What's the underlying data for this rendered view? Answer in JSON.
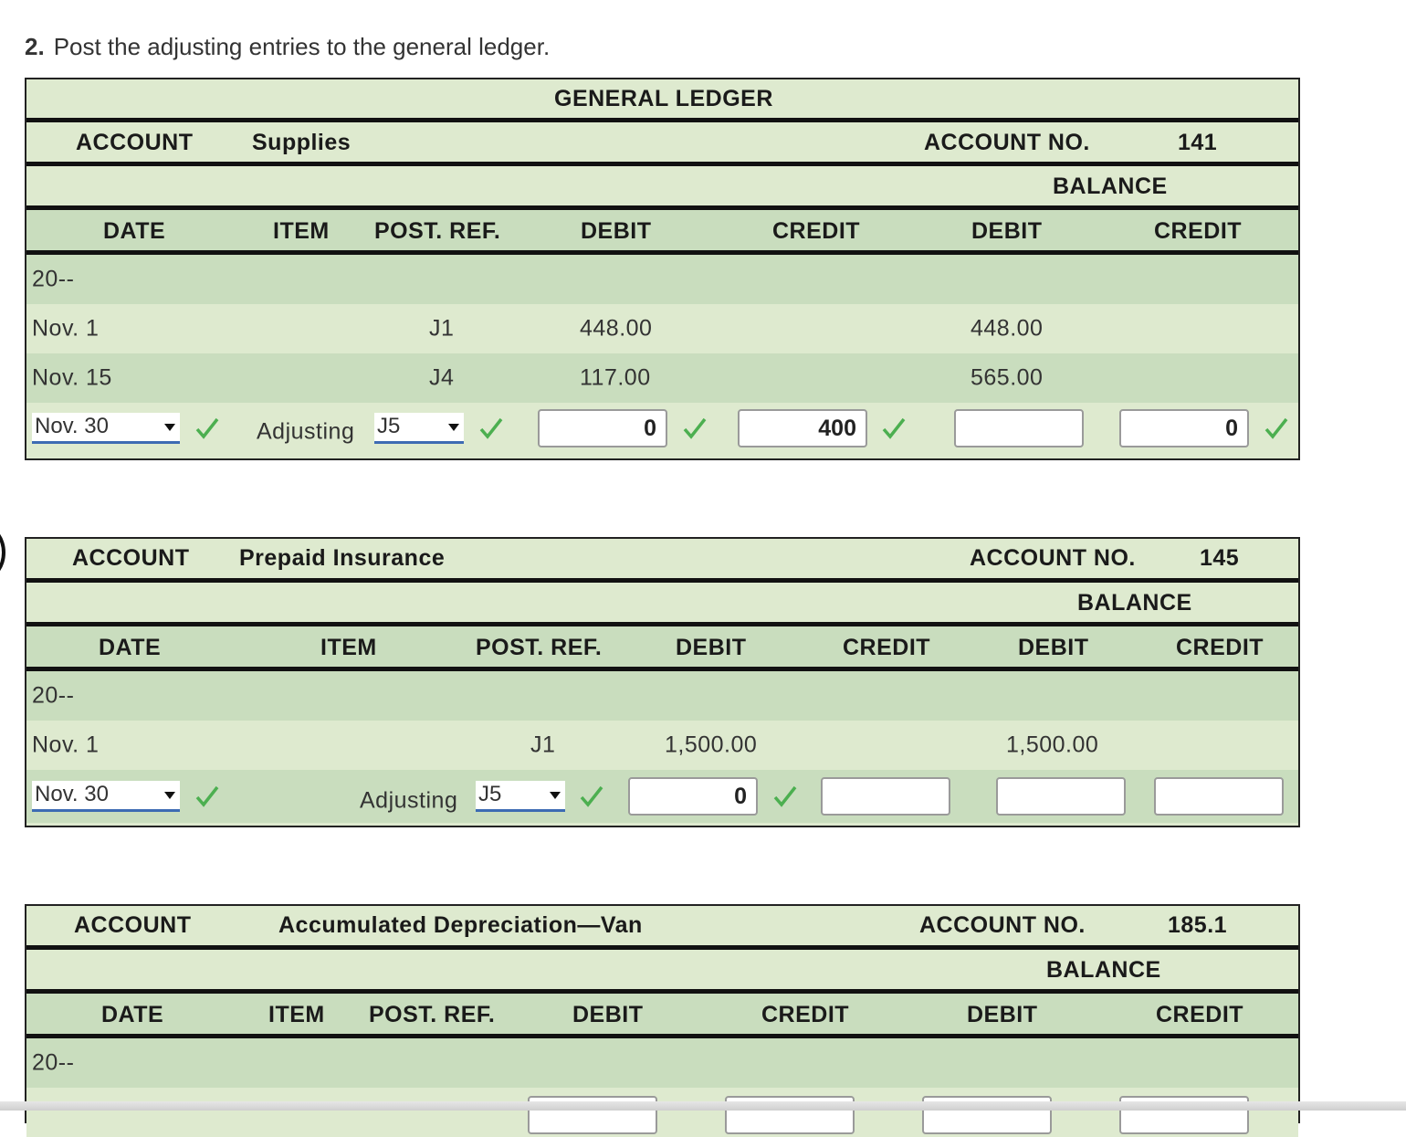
{
  "instruction": {
    "number": "2.",
    "text": "Post the adjusting entries to the general ledger."
  },
  "ledger_title": "GENERAL LEDGER",
  "colors": {
    "bg": "#deeacf",
    "row_dark": "#c9ddbe",
    "check": "#4caf50",
    "select_underline": "#3d6bb3"
  },
  "labels": {
    "account": "ACCOUNT",
    "account_no": "ACCOUNT NO.",
    "balance": "BALANCE",
    "date": "DATE",
    "item": "ITEM",
    "post_ref": "POST. REF.",
    "debit": "DEBIT",
    "credit": "CREDIT"
  },
  "accounts": [
    {
      "name": "Supplies",
      "number": "141",
      "year": "20--",
      "rows": [
        {
          "date": "Nov. 1",
          "ref": "J1",
          "debit": "448.00",
          "bal_debit": "448.00"
        },
        {
          "date": "Nov. 15",
          "ref": "J4",
          "debit": "117.00",
          "bal_debit": "565.00"
        }
      ],
      "entry": {
        "date": "Nov. 30",
        "item": "Adjusting",
        "ref": "J5",
        "debit": "0",
        "credit": "400",
        "bal_debit": "",
        "bal_credit": "0"
      }
    },
    {
      "name": "Prepaid Insurance",
      "number": "145",
      "year": "20--",
      "rows": [
        {
          "date": "Nov. 1",
          "ref": "J1",
          "debit": "1,500.00",
          "bal_debit": "1,500.00"
        }
      ],
      "entry": {
        "date": "Nov. 30",
        "item": "Adjusting",
        "ref": "J5",
        "debit": "0",
        "credit": "",
        "bal_debit": "",
        "bal_credit": ""
      }
    },
    {
      "name": "Accumulated Depreciation—Van",
      "number": "185.1",
      "year": "20--"
    }
  ]
}
